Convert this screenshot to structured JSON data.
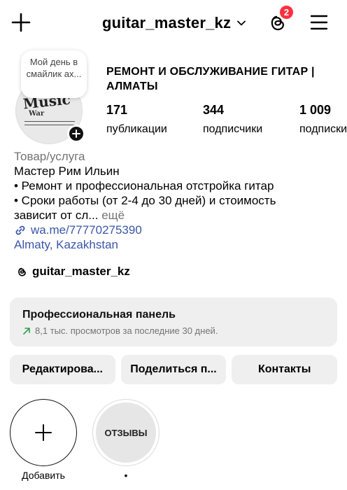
{
  "header": {
    "username": "guitar_master_kz",
    "notifications_count": "2"
  },
  "profile": {
    "note": "Мой день в смайлик ах...",
    "avatar_logo_line1": "Music",
    "avatar_logo_line2": "War",
    "name": "РЕМОНТ И ОБСЛУЖИВАНИЕ ГИТАР | АЛМАТЫ",
    "stats": [
      {
        "value": "171",
        "label": "публикации"
      },
      {
        "value": "344",
        "label": "подписчики"
      },
      {
        "value": "1 009",
        "label": "подписки"
      }
    ]
  },
  "bio": {
    "category": "Товар/услуга",
    "line1": "Мастер Рим Ильин",
    "line2": "• Ремонт и профессиональная отстройка гитар",
    "line3": "• Сроки работы (от 2-4 до 30 дней) и стоимость",
    "line4": "зависит от сл...",
    "more": " ещё",
    "link": "wa.me/77770275390",
    "location": "Almaty, Kazakhstan",
    "threads_handle": "guitar_master_kz"
  },
  "dashboard": {
    "title": "Профессиональная панель",
    "subtitle": "8,1 тыс. просмотров за последние 30 дней."
  },
  "actions": {
    "edit": "Редактирова...",
    "share": "Поделиться п...",
    "contacts": "Контакты"
  },
  "highlights": {
    "new_label": "Добавить",
    "reviews_cover": "ОТЗЫВЫ",
    "reviews_label": "•"
  },
  "colors": {
    "badge": "#ff3040",
    "link": "#3b56a8",
    "trend": "#2e9e4f",
    "panel_bg": "#efefef"
  }
}
